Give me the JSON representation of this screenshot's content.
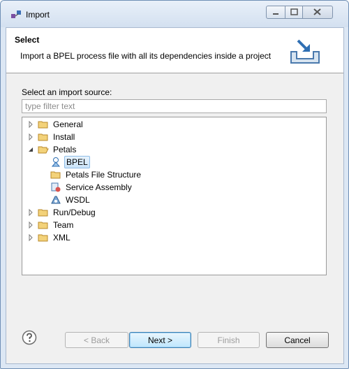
{
  "window": {
    "title": "Import"
  },
  "header": {
    "title": "Select",
    "description": "Import a BPEL process file with all its dependencies inside a project"
  },
  "source": {
    "label": "Select an import source:",
    "filter_placeholder": "type filter text",
    "filter_value": ""
  },
  "tree": [
    {
      "label": "General",
      "kind": "folder",
      "expanded": false
    },
    {
      "label": "Install",
      "kind": "folder",
      "expanded": false
    },
    {
      "label": "Petals",
      "kind": "folder",
      "expanded": true,
      "children": [
        {
          "label": "BPEL",
          "icon": "bpel-icon",
          "selected": true
        },
        {
          "label": "Petals File Structure",
          "icon": "folder-icon"
        },
        {
          "label": "Service Assembly",
          "icon": "service-assembly-icon"
        },
        {
          "label": "WSDL",
          "icon": "wsdl-icon"
        }
      ]
    },
    {
      "label": "Run/Debug",
      "kind": "folder",
      "expanded": false
    },
    {
      "label": "Team",
      "kind": "folder",
      "expanded": false
    },
    {
      "label": "XML",
      "kind": "folder",
      "expanded": false
    }
  ],
  "buttons": {
    "back": "< Back",
    "next": "Next >",
    "finish": "Finish",
    "cancel": "Cancel"
  },
  "colors": {
    "selection": "#cbe4f9",
    "folder": "#e8c15a",
    "accent": "#3c7fb1"
  }
}
